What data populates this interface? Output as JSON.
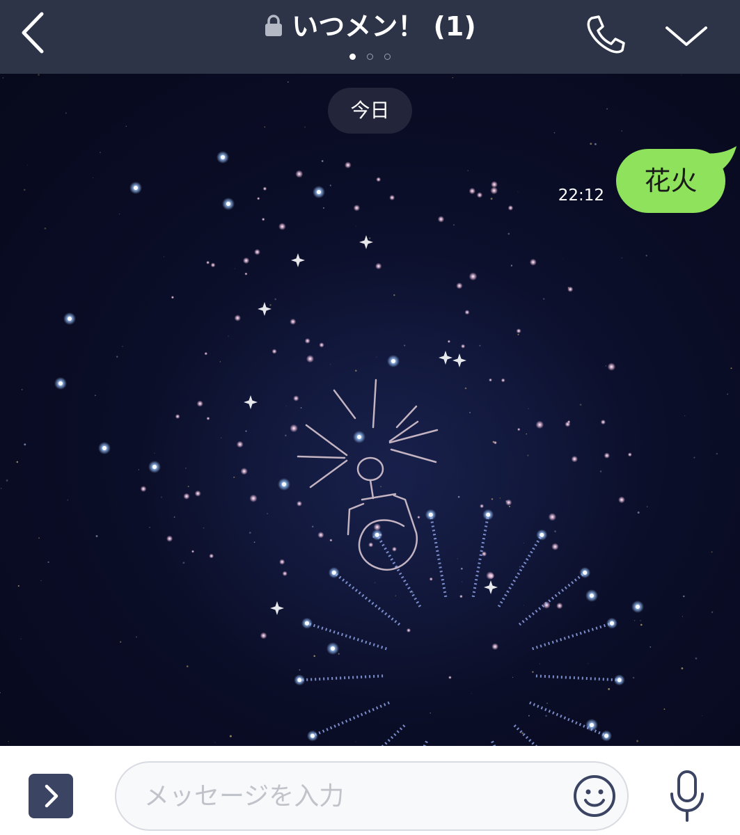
{
  "header": {
    "title": "いつメン！ (1)",
    "back_icon": "chevron-left-icon",
    "lock_icon": "lock-icon",
    "call_icon": "phone-icon",
    "menu_icon": "chevron-down-icon",
    "page_dots": {
      "count": 3,
      "active_index": 0
    }
  },
  "chat": {
    "date_label": "今日",
    "messages": [
      {
        "sender": "me",
        "text": "花火",
        "time": "22:12"
      }
    ]
  },
  "input_bar": {
    "placeholder": "メッセージを入力",
    "expand_icon": "chevron-right-icon",
    "emoji_icon": "smiley-icon",
    "mic_icon": "microphone-icon"
  },
  "colors": {
    "header_bg": "#2d3448",
    "chat_bg": "#0b0e24",
    "bubble_green": "#8ee25c",
    "expand_button": "#3b4563",
    "icon_gray": "#3b4563"
  }
}
